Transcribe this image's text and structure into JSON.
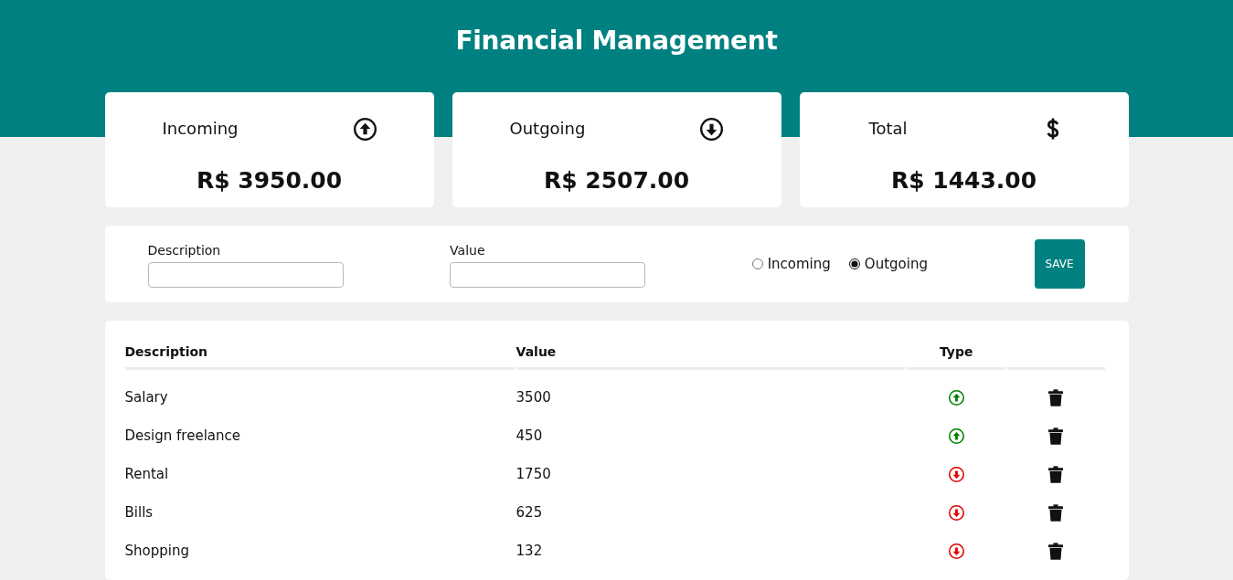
{
  "header": {
    "title": "Financial Management"
  },
  "summary": [
    {
      "kind": "incoming",
      "label": "Incoming",
      "amount": "R$ 3950.00"
    },
    {
      "kind": "outgoing",
      "label": "Outgoing",
      "amount": "R$ 2507.00"
    },
    {
      "kind": "total",
      "label": "Total",
      "amount": "R$ 1443.00"
    }
  ],
  "form": {
    "fields": [
      {
        "label": "Description"
      },
      {
        "label": "Value"
      }
    ],
    "type_options": [
      {
        "label": "Incoming",
        "selected": false
      },
      {
        "label": "Outgoing",
        "selected": true
      }
    ],
    "save_button": "SAVE"
  },
  "table": {
    "columns": [
      "Description",
      "Value",
      "Type"
    ],
    "rows": [
      {
        "description": "Salary",
        "value": "3500",
        "kind": "incoming"
      },
      {
        "description": "Design freelance",
        "value": "450",
        "kind": "incoming"
      },
      {
        "description": "Rental",
        "value": "1750",
        "kind": "outgoing"
      },
      {
        "description": "Bills",
        "value": "625",
        "kind": "outgoing"
      },
      {
        "description": "Shopping",
        "value": "132",
        "kind": "outgoing"
      }
    ]
  }
}
